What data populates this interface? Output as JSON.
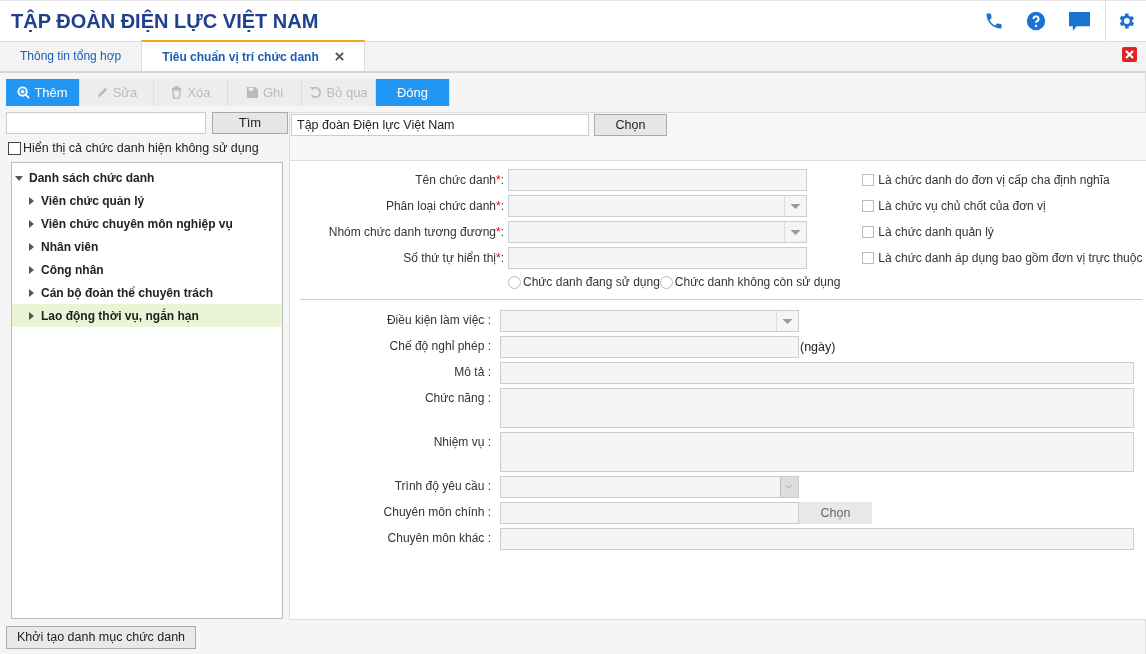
{
  "header": {
    "title": "TẬP ĐOÀN ĐIỆN LỰC VIỆT NAM"
  },
  "tabs": [
    {
      "label": "Thông tin tổng hợp",
      "selected": false
    },
    {
      "label": "Tiêu chuẩn vị trí chức danh",
      "selected": true
    }
  ],
  "toolbar": [
    {
      "label": "Thêm",
      "kind": "zoom",
      "disabled": false
    },
    {
      "label": "Sửa",
      "kind": "pencil",
      "disabled": true
    },
    {
      "label": "Xóa",
      "kind": "trash",
      "disabled": true
    },
    {
      "label": "Ghi",
      "kind": "save",
      "disabled": true
    },
    {
      "label": "Bỏ qua",
      "kind": "undo",
      "disabled": true
    },
    {
      "label": "Đóng",
      "kind": "plain",
      "disabled": false
    }
  ],
  "search": {
    "button": "Tìm"
  },
  "show_unused": {
    "label": "Hiển thị cả chức danh hiện không sử dụng",
    "checked": false
  },
  "tree": {
    "label": "Danh sách chức danh",
    "expanded": true,
    "children": [
      {
        "label": "Viên chức quản lý",
        "expanded": false,
        "selected": false
      },
      {
        "label": "Viên chức chuyên môn nghiệp vụ",
        "expanded": false,
        "selected": false
      },
      {
        "label": "Nhân viên",
        "expanded": false,
        "selected": false
      },
      {
        "label": "Công nhân",
        "expanded": false,
        "selected": false
      },
      {
        "label": "Cán bộ đoàn thể chuyên trách",
        "expanded": false,
        "selected": false
      },
      {
        "label": "Lao động thời vụ, ngắn hạn",
        "expanded": false,
        "selected": true
      }
    ]
  },
  "init_button": "Khởi tạo danh mục chức danh",
  "unit": {
    "value": "Tập đoàn Điện lực Việt Nam",
    "button": "Chọn"
  },
  "top_fields": [
    {
      "label": "Tên chức danh",
      "mark": "*",
      "tail": ":",
      "kind": "text"
    },
    {
      "label": "Phân loại chức danh",
      "mark": "*",
      "tail": ":",
      "kind": "select"
    },
    {
      "label": "Nhóm chức danh tương đương",
      "mark": "*",
      "tail": ":",
      "kind": "select"
    },
    {
      "label": "Số thứ tự hiển thị",
      "mark": "*",
      "tail": ":",
      "kind": "text"
    }
  ],
  "flags": [
    {
      "label": "Là chức danh do đơn vị cấp cha định nghĩa",
      "checked": false
    },
    {
      "label": "Là chức vụ chủ chốt của đơn vị",
      "checked": false
    },
    {
      "label": "Là chức danh quản lý",
      "checked": false
    },
    {
      "label": "Là chức danh áp dụng bao gồm đơn vị trực thuộc",
      "checked": false
    }
  ],
  "status_options": [
    {
      "label": "Chức danh đang sử dụng",
      "selected": false
    },
    {
      "label": "Chức danh không còn sử dụng",
      "selected": false
    }
  ],
  "detail_fields": [
    {
      "label": "Điều kiện làm việc :",
      "kind": "select"
    },
    {
      "label": "Chế độ nghỉ phép :",
      "kind": "unit",
      "unit": "(ngày)"
    },
    {
      "label": "Mô tả :",
      "kind": "wide"
    },
    {
      "label": "Chức năng :",
      "kind": "textarea"
    },
    {
      "label": "Nhiệm vụ :",
      "kind": "textarea"
    },
    {
      "label": "Trình độ yêu cầu :",
      "kind": "select_plain"
    },
    {
      "label": "Chuyên môn chính :",
      "kind": "button",
      "button": "Chọn"
    },
    {
      "label": "Chuyên môn khác :",
      "kind": "wide"
    }
  ]
}
